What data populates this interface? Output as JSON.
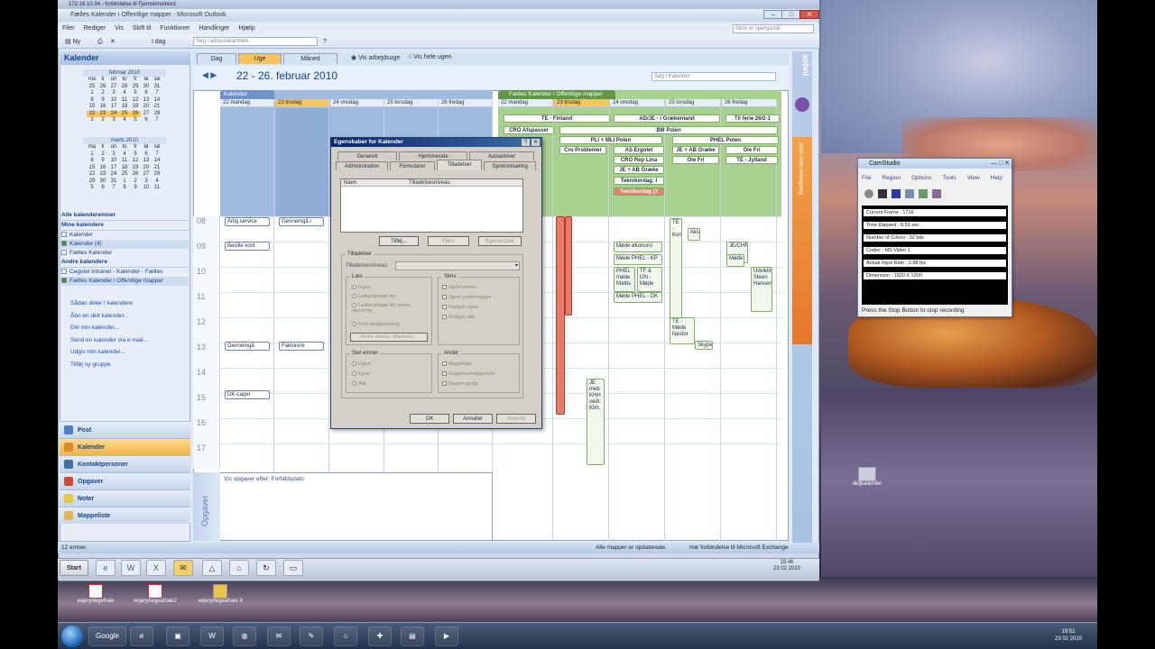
{
  "remote_title": "172.16.10.34 - forbindelse til Fjernskrivebord",
  "outlook": {
    "title": "Fælles Kalender i Offentlige mapper - Microsoft Outlook",
    "help_search": "Skriv et spørgsmål",
    "menu": [
      "Filer",
      "Rediger",
      "Vis",
      "Skift til",
      "Funktioner",
      "Handlinger",
      "Hjælp"
    ],
    "toolbar": {
      "new": "Ny",
      "today": "I dag",
      "search_placeholder": "Søg i adressekartotek"
    },
    "nav": {
      "header": "Kalender",
      "mini1": {
        "month": "februar 2010",
        "days": [
          "ma",
          "ti",
          "on",
          "to",
          "fr",
          "lø",
          "sø"
        ],
        "rows": [
          [
            "25",
            "26",
            "27",
            "28",
            "29",
            "30",
            "31"
          ],
          [
            "1",
            "2",
            "3",
            "4",
            "5",
            "6",
            "7"
          ],
          [
            "8",
            "9",
            "10",
            "11",
            "12",
            "13",
            "14"
          ],
          [
            "15",
            "16",
            "17",
            "18",
            "19",
            "20",
            "21"
          ],
          [
            "22",
            "23",
            "24",
            "25",
            "26",
            "27",
            "28"
          ],
          [
            "1",
            "2",
            "3",
            "4",
            "5",
            "6",
            "7"
          ]
        ]
      },
      "mini2": {
        "month": "marts 2010",
        "days": [
          "ma",
          "ti",
          "on",
          "to",
          "fr",
          "lø",
          "sø"
        ],
        "rows": [
          [
            "1",
            "2",
            "3",
            "4",
            "5",
            "6",
            "7"
          ],
          [
            "8",
            "9",
            "10",
            "11",
            "12",
            "13",
            "14"
          ],
          [
            "15",
            "16",
            "17",
            "18",
            "19",
            "20",
            "21"
          ],
          [
            "22",
            "23",
            "24",
            "25",
            "26",
            "27",
            "28"
          ],
          [
            "29",
            "30",
            "31",
            "1",
            "2",
            "3",
            "4"
          ],
          [
            "5",
            "6",
            "7",
            "8",
            "9",
            "10",
            "11"
          ]
        ]
      },
      "all_cals": "Alle kalenderemner",
      "my_cals_header": "Mine kalendere",
      "my_cals": [
        "Kalender",
        "Kalender (4)",
        "Fælles Kalender"
      ],
      "other_header": "Andre kalendere",
      "other_cals": [
        "Cegolet Intranet - Kalender - Fælles",
        "Fælles Kalender i Offentlige mapper"
      ],
      "links": [
        "Sådan deler I kalendere",
        "Åbn en delt kalender...",
        "Del min kalender...",
        "Send en kalender via e-mail...",
        "Udgiv min kalender...",
        "Tilføj ny gruppe"
      ],
      "buttons": [
        "Post",
        "Kalender",
        "Kontaktpersoner",
        "Opgaver",
        "Noter",
        "Mappeliste"
      ]
    },
    "status_left": "12 emner",
    "status_right": "Alle mapper er opdaterede.",
    "status_conn": "Har forbindelse til Microsoft Exchange",
    "view_tabs": [
      "Dag",
      "Uge",
      "Måned"
    ],
    "view_opts": [
      "Vis arbejdsuge",
      "Vis hele ugen"
    ],
    "date_range": "22 - 26. februar 2010",
    "search_cal": "Søg i Kalender",
    "left_cal": {
      "name": "Kalender",
      "days": [
        "22 mandag",
        "23 tirsdag",
        "24 onsdag",
        "25 torsdag",
        "26 fredag"
      ]
    },
    "right_cal": {
      "name": "Fælles Kalender i Offentlige mapper",
      "days": [
        "22 mandag",
        "23 tirsdag",
        "24 onsdag",
        "25 torsdag",
        "26 fredag"
      ]
    },
    "hours": [
      "08",
      "09",
      "10",
      "11",
      "12",
      "13",
      "14",
      "15",
      "16",
      "17"
    ],
    "left_appts": [
      "Årlig service",
      "Gennemgå r",
      "Besille kont",
      "Gennemgå",
      "Fakturere",
      "DK-Lager"
    ],
    "banners": [
      "TE - Finland",
      "AD/JE - i Grækenland",
      "Til ferie 26/2-1",
      "CRO Afspasser",
      "BM Polen",
      "PLI + MLI Polen",
      "PHEL Polen",
      "Cro Problemer",
      "AS Ergolet",
      "JE + AB Græke",
      "Ole Fri",
      "CRO Rep Lina",
      "Ole Fri",
      "TE - Jylland",
      "JE + AB Græke",
      "Teknikerdag: I",
      "Teknikerdag (3"
    ],
    "right_appts": [
      "Møde økonomi",
      "Møde PHEL - KP",
      "PHEL møde Mattis",
      "TF & GN - Møde",
      "Møde PHEL - DK",
      "TE - Kon",
      "Aksl",
      "JE/CHR",
      "Møde",
      "TE - Møde Nestor",
      "Skype",
      "JE meb KHH vedr. Kbh.",
      "Udviklin Steen Hansen"
    ],
    "tasks_title": "Vis opgaver efter: Forfaldsdato",
    "tasks_side": "Opgaver",
    "todo_bar": "Altan Dato Ansøgning"
  },
  "dialog": {
    "title": "Egenskaber for Kalender",
    "tabs_row1": [
      "Generelt",
      "Hjemmeside",
      "Autoarkiver"
    ],
    "tabs_row2": [
      "Administration",
      "Formularer",
      "Tilladelser",
      "Synkronisering"
    ],
    "col_name": "Navn",
    "col_perm": "Tilladelsesniveau",
    "btn_add": "Tilføj...",
    "btn_remove": "Fjern",
    "btn_props": "Egenskaber",
    "perms_header": "Tilladelser",
    "perm_level_label": "Tilladelsesniveau:",
    "read": {
      "title": "Læs",
      "opts": [
        "Ingen",
        "Ledig/optaget tid",
        "Ledig/optaget tid, emne, placering",
        "Fuld detaljevisning"
      ],
      "btn": "Andre detaljer tilladelser..."
    },
    "write": {
      "title": "Skriv",
      "opts": [
        "Opret emner",
        "Opret undermapper",
        "Rediger egne",
        "Rediger alle"
      ]
    },
    "delete": {
      "title": "Slet emner",
      "opts": [
        "Ingen",
        "Egne",
        "Alle"
      ]
    },
    "other": {
      "title": "Andet",
      "opts": [
        "Mappeejer",
        "Mappekontaktperson",
        "Mappe synlig"
      ]
    },
    "ok": "OK",
    "cancel": "Annuller",
    "apply": "Anvend"
  },
  "camstudio": {
    "title": "CamStudio",
    "menu": [
      "File",
      "Region",
      "Options",
      "Tools",
      "View",
      "Help"
    ],
    "rows": [
      "Current Frame : 1716",
      "Time Elapsed : 8.59 sec",
      "Number of Colors : 32 bits",
      "Codec : MS Video 1",
      "Actual Input Rate : 2.88 fps",
      "Dimension : 1920 X 1200"
    ],
    "status": "Press the Stop Button to stop recording"
  },
  "desktop_icons": [
    "deljkalender",
    "vejeryrlegefrale",
    "vejeryrlegeafrale2",
    "vejeryrlegeafrale 3"
  ],
  "xp_taskbar": {
    "start": "Start",
    "time": "19:46",
    "date": "23 02 2010"
  },
  "win7_taskbar": {
    "time": "19:51",
    "date": "23 02 2010",
    "google": "Google"
  }
}
